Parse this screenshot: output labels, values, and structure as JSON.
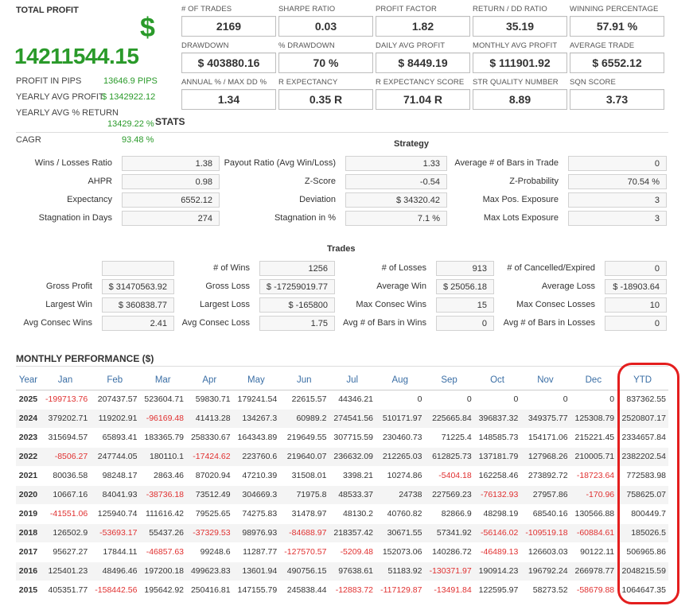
{
  "summary": {
    "title": "TOTAL PROFIT",
    "currency_symbol": "$",
    "total_profit": "14211544.15",
    "profit_in_pips_label": "PROFIT IN PIPS",
    "profit_in_pips": "13646.9 PIPS",
    "yearly_avg_profit_label": "YEARLY AVG PROFIT",
    "yearly_avg_profit": "$ 1342922.12",
    "yearly_avg_return_label": "YEARLY AVG % RETURN",
    "yearly_avg_return": "13429.22 %",
    "cagr_label": "CAGR",
    "cagr": "93.48 %"
  },
  "metrics": [
    {
      "label": "# OF TRADES",
      "value": "2169"
    },
    {
      "label": "SHARPE RATIO",
      "value": "0.03"
    },
    {
      "label": "PROFIT FACTOR",
      "value": "1.82"
    },
    {
      "label": "RETURN / DD RATIO",
      "value": "35.19"
    },
    {
      "label": "WINNING PERCENTAGE",
      "value": "57.91 %"
    },
    {
      "label": "DRAWDOWN",
      "value": "$ 403880.16"
    },
    {
      "label": "% DRAWDOWN",
      "value": "70 %"
    },
    {
      "label": "DAILY AVG PROFIT",
      "value": "$ 8449.19"
    },
    {
      "label": "MONTHLY AVG PROFIT",
      "value": "$ 111901.92"
    },
    {
      "label": "AVERAGE TRADE",
      "value": "$ 6552.12"
    },
    {
      "label": "ANNUAL % / MAX DD %",
      "value": "1.34"
    },
    {
      "label": "R EXPECTANCY",
      "value": "0.35 R"
    },
    {
      "label": "R EXPECTANCY SCORE",
      "value": "71.04 R"
    },
    {
      "label": "STR QUALITY NUMBER",
      "value": "8.89"
    },
    {
      "label": "SQN SCORE",
      "value": "3.73"
    }
  ],
  "stats_title": "STATS",
  "strategy": {
    "title": "Strategy",
    "rows": [
      [
        {
          "label": "Wins / Losses Ratio",
          "value": "1.38"
        },
        {
          "label": "Payout Ratio (Avg Win/Loss)",
          "value": "1.33"
        },
        {
          "label": "Average # of Bars in Trade",
          "value": "0"
        }
      ],
      [
        {
          "label": "AHPR",
          "value": "0.98"
        },
        {
          "label": "Z-Score",
          "value": "-0.54"
        },
        {
          "label": "Z-Probability",
          "value": "70.54 %"
        }
      ],
      [
        {
          "label": "Expectancy",
          "value": "6552.12"
        },
        {
          "label": "Deviation",
          "value": "$ 34320.42"
        },
        {
          "label": "Max Pos. Exposure",
          "value": "3"
        }
      ],
      [
        {
          "label": "Stagnation in Days",
          "value": "274"
        },
        {
          "label": "Stagnation in %",
          "value": "7.1 %"
        },
        {
          "label": "Max Lots Exposure",
          "value": "3"
        }
      ]
    ]
  },
  "trades": {
    "title": "Trades",
    "rows": [
      [
        {
          "label": "",
          "value": ""
        },
        {
          "label": "# of Wins",
          "value": "1256"
        },
        {
          "label": "# of Losses",
          "value": "913"
        },
        {
          "label": "# of Cancelled/Expired",
          "value": "0"
        }
      ],
      [
        {
          "label": "Gross Profit",
          "value": "$ 31470563.92"
        },
        {
          "label": "Gross Loss",
          "value": "$ -17259019.77"
        },
        {
          "label": "Average Win",
          "value": "$ 25056.18"
        },
        {
          "label": "Average Loss",
          "value": "$ -18903.64"
        }
      ],
      [
        {
          "label": "Largest Win",
          "value": "$ 360838.77"
        },
        {
          "label": "Largest Loss",
          "value": "$ -165800"
        },
        {
          "label": "Max Consec Wins",
          "value": "15"
        },
        {
          "label": "Max Consec Losses",
          "value": "10"
        }
      ],
      [
        {
          "label": "Avg Consec Wins",
          "value": "2.41"
        },
        {
          "label": "Avg Consec Loss",
          "value": "1.75"
        },
        {
          "label": "Avg # of Bars in Wins",
          "value": "0"
        },
        {
          "label": "Avg # of Bars in Losses",
          "value": "0"
        }
      ]
    ]
  },
  "monthly": {
    "title": "MONTHLY PERFORMANCE ($)",
    "headers": [
      "Year",
      "Jan",
      "Feb",
      "Mar",
      "Apr",
      "May",
      "Jun",
      "Jul",
      "Aug",
      "Sep",
      "Oct",
      "Nov",
      "Dec",
      "YTD"
    ],
    "rows": [
      [
        "2025",
        "-199713.76",
        "207437.57",
        "523604.71",
        "59830.71",
        "179241.54",
        "22615.57",
        "44346.21",
        "0",
        "0",
        "0",
        "0",
        "0",
        "837362.55"
      ],
      [
        "2024",
        "379202.71",
        "119202.91",
        "-96169.48",
        "41413.28",
        "134267.3",
        "60989.2",
        "274541.56",
        "510171.97",
        "225665.84",
        "396837.32",
        "349375.77",
        "125308.79",
        "2520807.17"
      ],
      [
        "2023",
        "315694.57",
        "65893.41",
        "183365.79",
        "258330.67",
        "164343.89",
        "219649.55",
        "307715.59",
        "230460.73",
        "71225.4",
        "148585.73",
        "154171.06",
        "215221.45",
        "2334657.84"
      ],
      [
        "2022",
        "-8506.27",
        "247744.05",
        "180110.1",
        "-17424.62",
        "223760.6",
        "219640.07",
        "236632.09",
        "212265.03",
        "612825.73",
        "137181.79",
        "127968.26",
        "210005.71",
        "2382202.54"
      ],
      [
        "2021",
        "80036.58",
        "98248.17",
        "2863.46",
        "87020.94",
        "47210.39",
        "31508.01",
        "3398.21",
        "10274.86",
        "-5404.18",
        "162258.46",
        "273892.72",
        "-18723.64",
        "772583.98"
      ],
      [
        "2020",
        "10667.16",
        "84041.93",
        "-38736.18",
        "73512.49",
        "304669.3",
        "71975.8",
        "48533.37",
        "24738",
        "227569.23",
        "-76132.93",
        "27957.86",
        "-170.96",
        "758625.07"
      ],
      [
        "2019",
        "-41551.06",
        "125940.74",
        "111616.42",
        "79525.65",
        "74275.83",
        "31478.97",
        "48130.2",
        "40760.82",
        "82866.9",
        "48298.19",
        "68540.16",
        "130566.88",
        "800449.7"
      ],
      [
        "2018",
        "126502.9",
        "-53693.17",
        "55437.26",
        "-37329.53",
        "98976.93",
        "-84688.97",
        "218357.42",
        "30671.55",
        "57341.92",
        "-56146.02",
        "-109519.18",
        "-60884.61",
        "185026.5"
      ],
      [
        "2017",
        "95627.27",
        "17844.11",
        "-46857.63",
        "99248.6",
        "11287.77",
        "-127570.57",
        "-5209.48",
        "152073.06",
        "140286.72",
        "-46489.13",
        "126603.03",
        "90122.11",
        "506965.86"
      ],
      [
        "2016",
        "125401.23",
        "48496.46",
        "197200.18",
        "499623.83",
        "13601.94",
        "490756.15",
        "97638.61",
        "51183.92",
        "-130371.97",
        "190914.23",
        "196792.24",
        "266978.77",
        "2048215.59"
      ],
      [
        "2015",
        "405351.77",
        "-158442.56",
        "195642.92",
        "250416.81",
        "147155.79",
        "245838.44",
        "-12883.72",
        "-117129.87",
        "-13491.84",
        "122595.97",
        "58273.52",
        "-58679.88",
        "1064647.35"
      ]
    ]
  },
  "colors": {
    "positive": "#2a9a2a",
    "negative": "#e03030",
    "header": "#3a6ea5",
    "highlight": "#e41e1e"
  }
}
